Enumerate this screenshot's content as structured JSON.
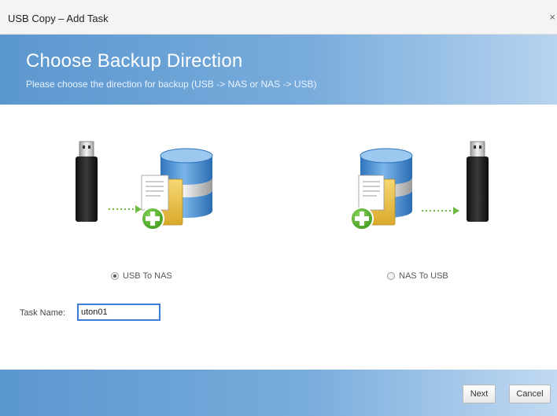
{
  "window": {
    "title": "USB Copy – Add Task",
    "close_glyph": "×"
  },
  "header": {
    "title": "Choose Backup Direction",
    "subtitle": "Please choose the direction for backup (USB -> NAS or NAS -> USB)"
  },
  "options": [
    {
      "label": "USB To NAS",
      "selected": true,
      "icon": "usb-to-nas-illustration"
    },
    {
      "label": "NAS To USB",
      "selected": false,
      "icon": "nas-to-usb-illustration"
    }
  ],
  "task": {
    "label": "Task Name:",
    "value": "uton01"
  },
  "footer": {
    "next_label": "Next",
    "cancel_label": "Cancel"
  },
  "colors": {
    "header_gradient_start": "#5b97cf",
    "header_gradient_end": "#b7d3ef",
    "plus_green": "#58b531",
    "arrow_green": "#6dbb3f",
    "db_blue": "#3d88d2",
    "input_border": "#3a7fd5"
  }
}
